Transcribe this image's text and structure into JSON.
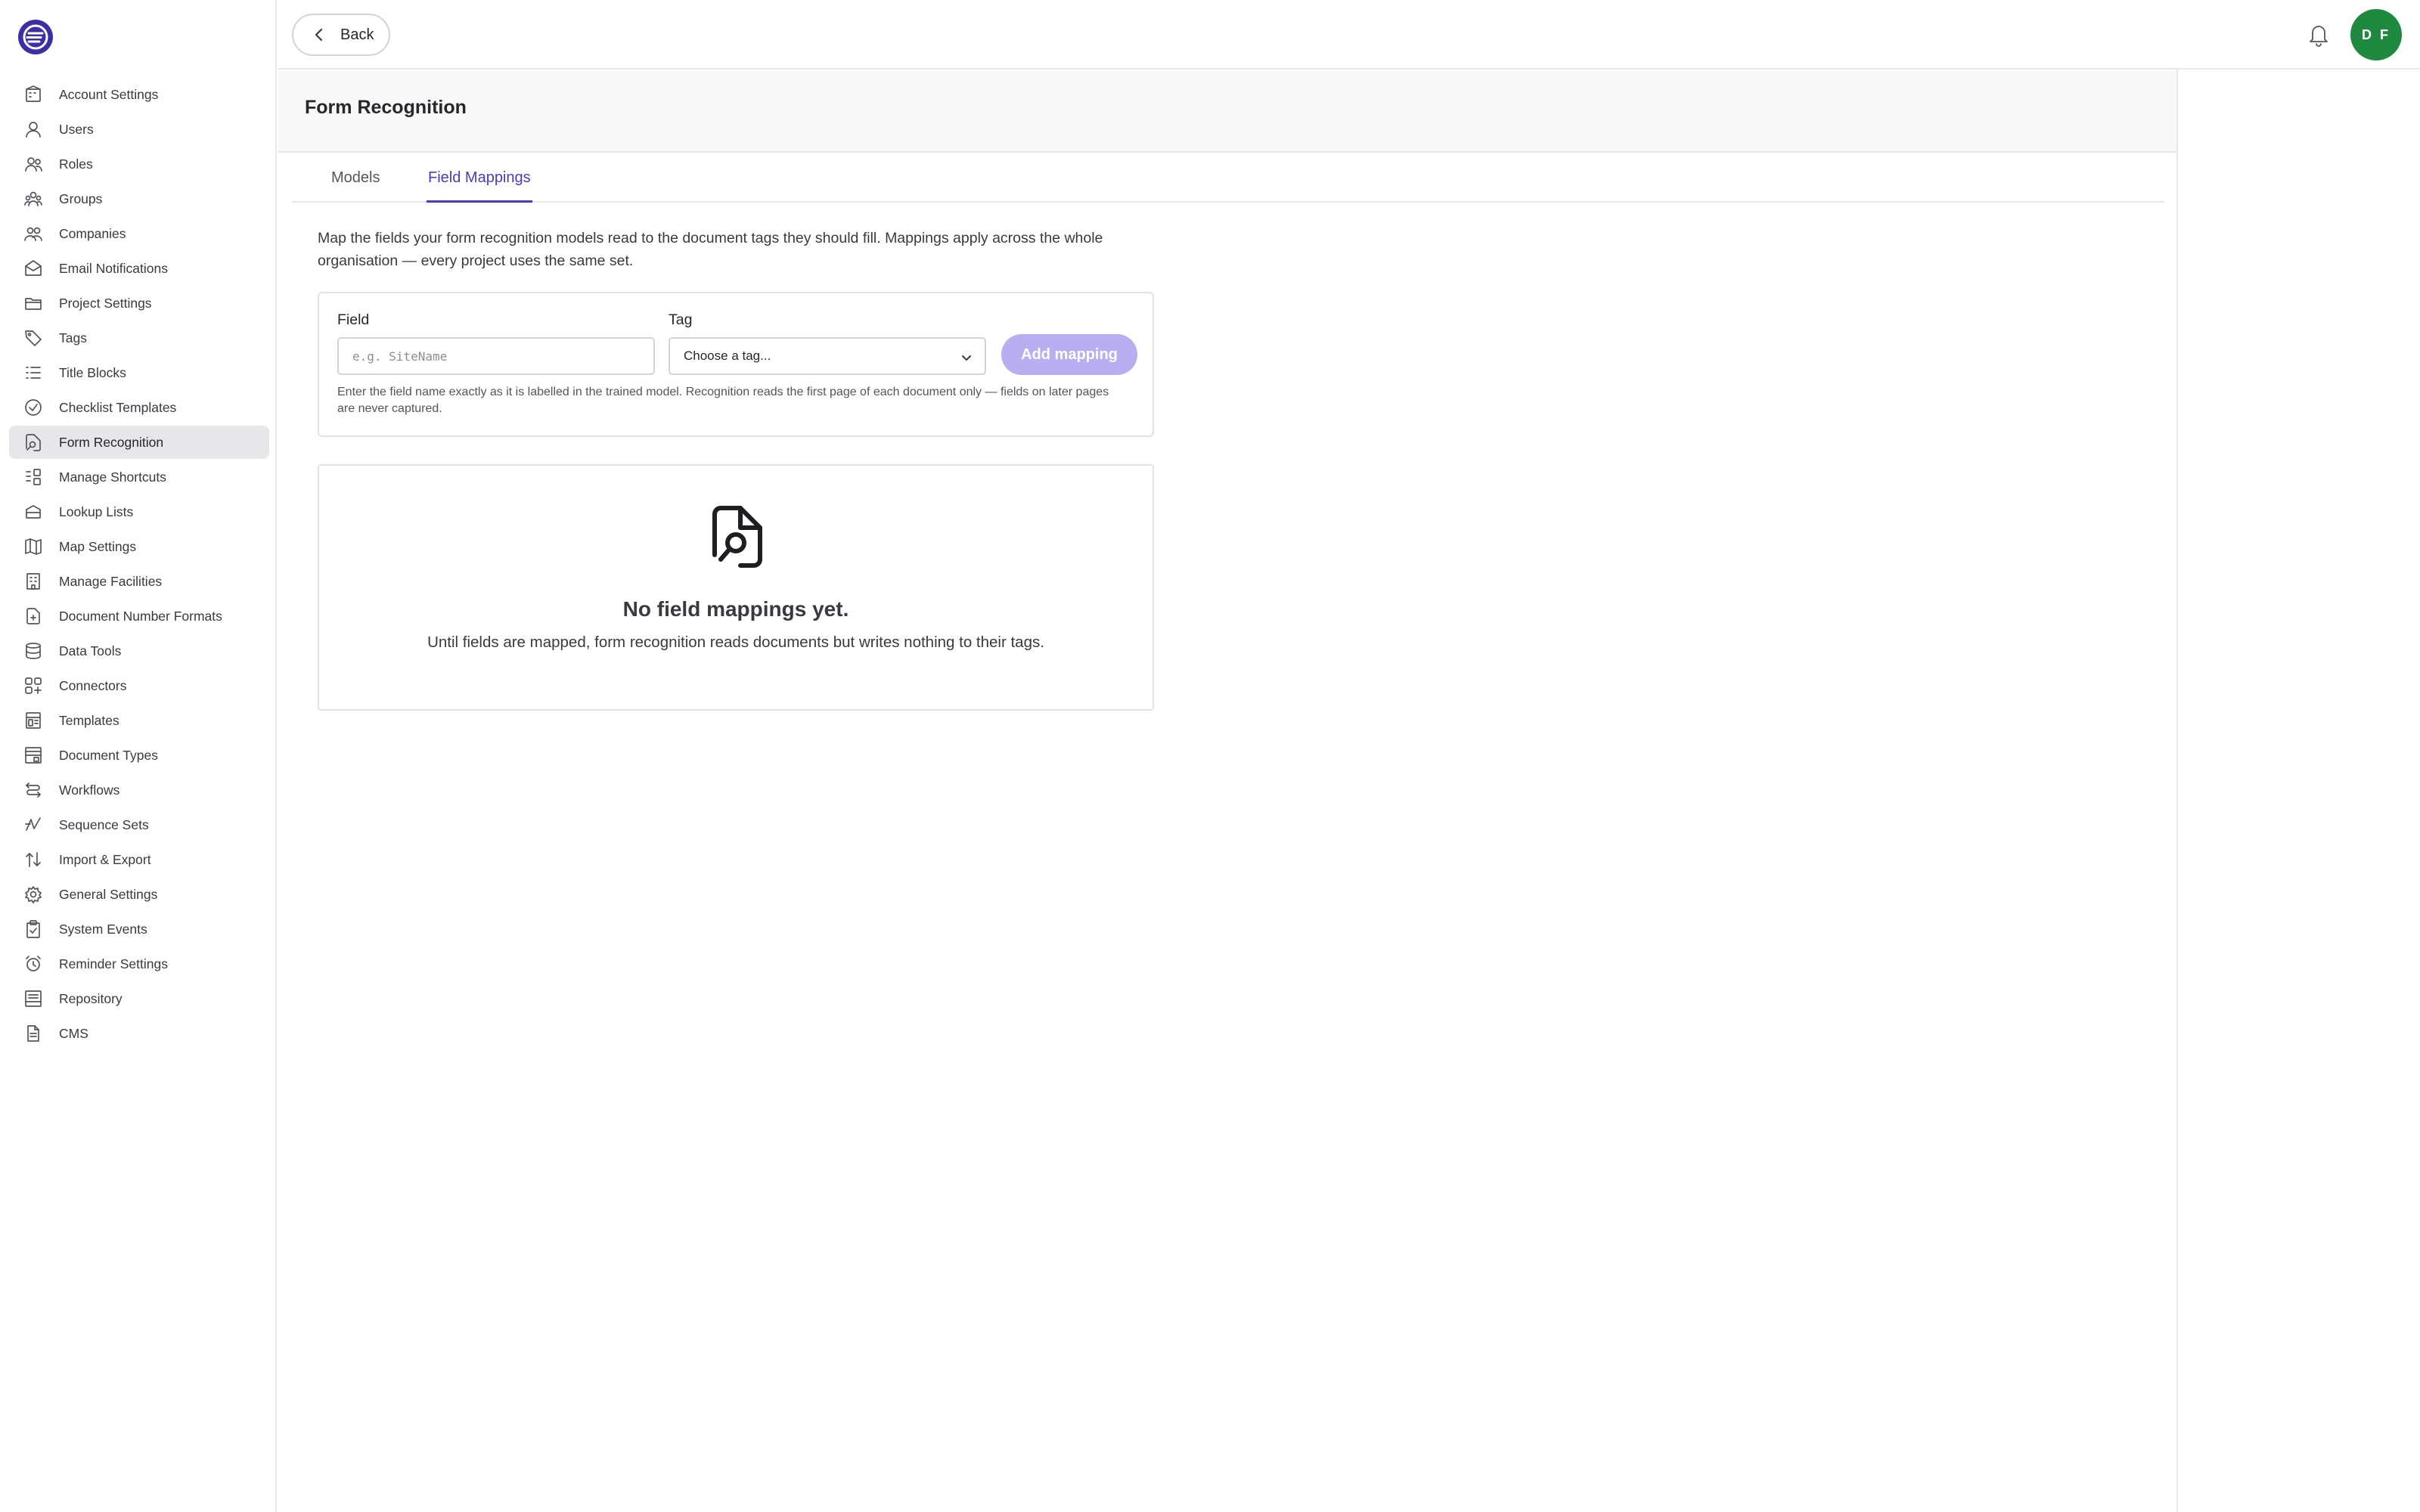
{
  "header": {
    "back_label": "Back",
    "avatar_initials": "D F"
  },
  "sidebar": {
    "items": [
      {
        "label": "Account Settings",
        "icon": "building-icon"
      },
      {
        "label": "Users",
        "icon": "user-icon"
      },
      {
        "label": "Roles",
        "icon": "roles-icon"
      },
      {
        "label": "Groups",
        "icon": "groups-icon"
      },
      {
        "label": "Companies",
        "icon": "companies-icon"
      },
      {
        "label": "Email Notifications",
        "icon": "mail-icon"
      },
      {
        "label": "Project Settings",
        "icon": "folder-icon"
      },
      {
        "label": "Tags",
        "icon": "tag-icon"
      },
      {
        "label": "Title Blocks",
        "icon": "list-icon"
      },
      {
        "label": "Checklist Templates",
        "icon": "check-circle-icon"
      },
      {
        "label": "Form Recognition",
        "icon": "file-search-icon",
        "active": true
      },
      {
        "label": "Manage Shortcuts",
        "icon": "shortcut-icon"
      },
      {
        "label": "Lookup Lists",
        "icon": "stack-icon"
      },
      {
        "label": "Map Settings",
        "icon": "map-icon"
      },
      {
        "label": "Manage Facilities",
        "icon": "facility-icon"
      },
      {
        "label": "Document Number Formats",
        "icon": "file-plus-icon"
      },
      {
        "label": "Data Tools",
        "icon": "database-icon"
      },
      {
        "label": "Connectors",
        "icon": "apps-icon"
      },
      {
        "label": "Templates",
        "icon": "template-icon"
      },
      {
        "label": "Document Types",
        "icon": "doc-types-icon"
      },
      {
        "label": "Workflows",
        "icon": "workflow-icon"
      },
      {
        "label": "Sequence Sets",
        "icon": "sequence-icon"
      },
      {
        "label": "Import & Export",
        "icon": "import-export-icon"
      },
      {
        "label": "General Settings",
        "icon": "gear-icon"
      },
      {
        "label": "System Events",
        "icon": "clipboard-check-icon"
      },
      {
        "label": "Reminder Settings",
        "icon": "alarm-icon"
      },
      {
        "label": "Repository",
        "icon": "repository-icon"
      },
      {
        "label": "CMS",
        "icon": "document-icon"
      }
    ]
  },
  "page": {
    "title": "Form Recognition",
    "tabs": [
      {
        "label": "Models",
        "active": false
      },
      {
        "label": "Field Mappings",
        "active": true
      }
    ],
    "description": "Map the fields your form recognition models read to the document tags they should fill. Mappings apply across the whole organisation — every project uses the same set.",
    "form": {
      "field_label": "Field",
      "field_placeholder": "e.g. SiteName",
      "tag_label": "Tag",
      "tag_selected": "Choose a tag...",
      "add_button": "Add mapping",
      "hint": "Enter the field name exactly as it is labelled in the trained model. Recognition reads the first page of each document only — fields on later pages are never captured."
    },
    "empty_state": {
      "title": "No field mappings yet.",
      "text": "Until fields are mapped, form recognition reads documents but writes nothing to their tags."
    }
  },
  "colors": {
    "accent": "#4a3bb8",
    "add_button_disabled": "#b9aef0",
    "avatar": "#1f8a3f",
    "logo": "#3b2fa6"
  }
}
